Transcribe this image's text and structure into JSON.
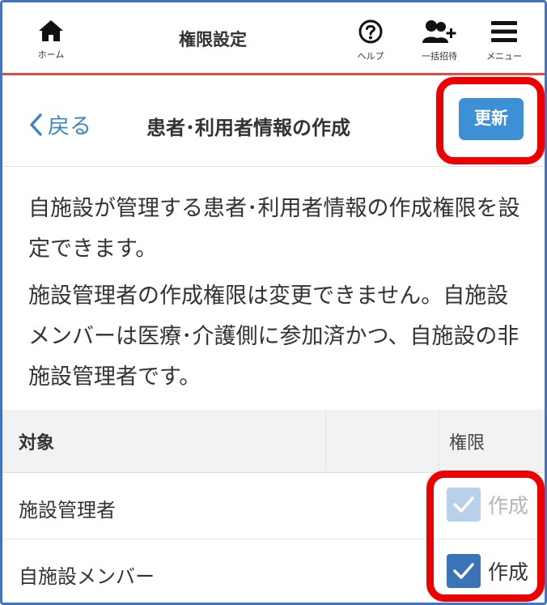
{
  "topbar": {
    "title": "権限設定",
    "home_label": "ホーム",
    "help_label": "ヘルプ",
    "invite_label": "一括招待",
    "menu_label": "メニュー"
  },
  "subheader": {
    "back_label": "戻る",
    "title": "患者･利用者情報の作成",
    "update_label": "更新"
  },
  "description": {
    "paragraph1": "自施設が管理する患者･利用者情報の作成権限を設定できます。",
    "paragraph2": "施設管理者の作成権限は変更できません。自施設メンバーは医療･介護側に参加済かつ、自施設の非施設管理者です。"
  },
  "table": {
    "headers": {
      "target": "対象",
      "permission": "権限"
    },
    "rows": [
      {
        "label": "施設管理者",
        "permission_label": "作成",
        "checked": true,
        "disabled": true
      },
      {
        "label": "自施設メンバー",
        "permission_label": "作成",
        "checked": true,
        "disabled": false
      }
    ]
  },
  "colors": {
    "accent": "#3d8fd6",
    "link": "#3d85c6",
    "topbar_border": "#e24a4a",
    "highlight": "#ee0000",
    "checkbox_enabled": "#3a73b8",
    "checkbox_disabled": "#b8d0ea"
  },
  "icons": {
    "home": "home-icon",
    "help": "help-circle-icon",
    "invite": "add-users-icon",
    "menu": "hamburger-menu-icon",
    "back": "chevron-left-icon",
    "check": "checkmark-icon"
  }
}
